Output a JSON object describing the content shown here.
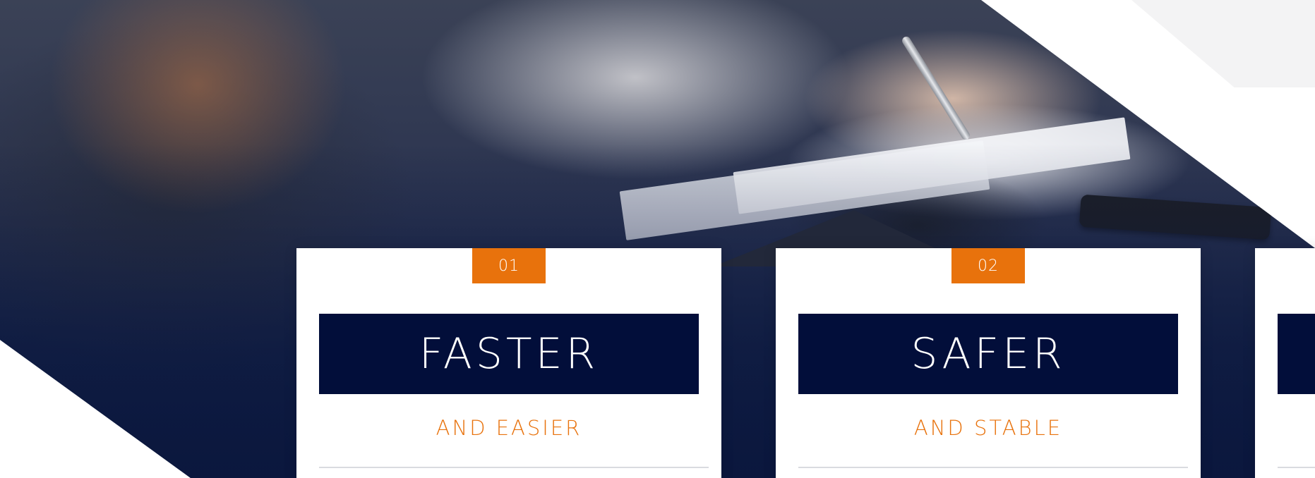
{
  "colors": {
    "accent": "#e8720c",
    "navy": "#020e3a",
    "card_background": "#ffffff"
  },
  "hero": {
    "image": "people-signing-documents-photo"
  },
  "cards": [
    {
      "number": "01",
      "title": "FASTER",
      "subtitle": "AND EASIER"
    },
    {
      "number": "02",
      "title": "SAFER",
      "subtitle": "AND STABLE"
    },
    {
      "number": "",
      "title": "",
      "subtitle": ""
    }
  ]
}
